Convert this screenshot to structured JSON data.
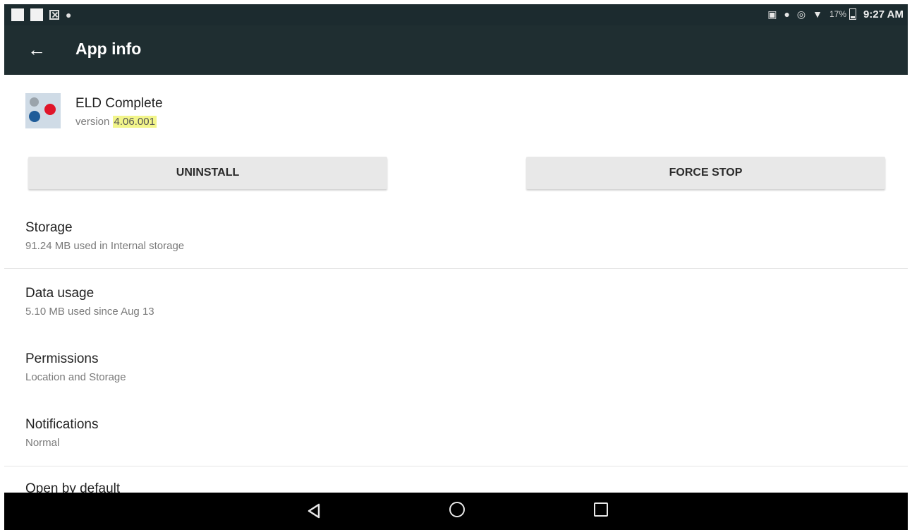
{
  "status_bar": {
    "battery_percent": "17%",
    "time": "9:27 AM",
    "left_icons": [
      "notification-square-icon",
      "notification-square-icon",
      "close-box-icon",
      "notification-dot-icon"
    ],
    "right_icons": [
      "cast-icon",
      "location-icon",
      "sync-icon",
      "wifi-icon",
      "battery-icon"
    ]
  },
  "app_bar": {
    "back_icon": "arrow-back-icon",
    "title": "App info",
    "background_color": "#1f2e31"
  },
  "app": {
    "name": "ELD Complete",
    "version_label": "version",
    "version_number": "4.06.001",
    "highlight_color": "#f2f58a"
  },
  "buttons": {
    "uninstall": "UNINSTALL",
    "force_stop": "FORCE STOP"
  },
  "settings_items": [
    {
      "title": "Storage",
      "subtitle": "91.24 MB used in Internal storage"
    },
    {
      "title": "Data usage",
      "subtitle": "5.10 MB used since Aug 13"
    },
    {
      "title": "Permissions",
      "subtitle": "Location and Storage"
    },
    {
      "title": "Notifications",
      "subtitle": "Normal"
    },
    {
      "title": "Open by default",
      "subtitle": ""
    }
  ],
  "nav_bar": {
    "icons": [
      "nav-back-icon",
      "nav-home-icon",
      "nav-recents-icon"
    ]
  }
}
